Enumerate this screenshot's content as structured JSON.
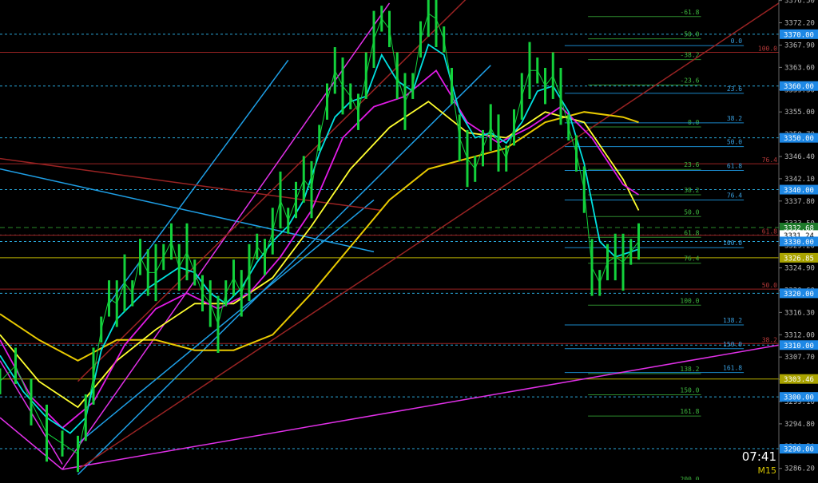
{
  "chart_data": {
    "type": "line",
    "timeframe": "M15",
    "clock": "07:41",
    "ylim": [
      3284.0,
      3376.6
    ],
    "xlim": [
      0,
      100
    ],
    "grid": false,
    "colors": {
      "background": "#000000",
      "price_bars": "#13d13b",
      "ema_fast": "#00e1e1",
      "ema_mid": "#e11be6",
      "ema_slow": "#ffff2f",
      "ma_long": "#e8c900",
      "ma_stair": "#6e66ff",
      "channel_blue": "#1e9fe6",
      "channel_magenta": "#e130e8",
      "trend_red": "#9a2323",
      "fib_green": "#2d8b2d",
      "fib_blue": "#1a87c8",
      "level_dashed": "#2aa6d8",
      "current_price": "#2a8a2a"
    },
    "price_ticks": [
      "3376.50",
      "3372.20",
      "3367.90",
      "3363.60",
      "3359.30",
      "3355.00",
      "3350.70",
      "3346.40",
      "3342.10",
      "3337.80",
      "3333.50",
      "3329.20",
      "3324.90",
      "3320.60",
      "3316.30",
      "3312.00",
      "3307.70",
      "3303.40",
      "3299.10",
      "3294.80",
      "3290.50",
      "3286.20"
    ],
    "tick_values": [
      3376.5,
      3372.2,
      3367.9,
      3363.6,
      3359.3,
      3355.0,
      3350.7,
      3346.4,
      3342.1,
      3337.8,
      3333.5,
      3329.2,
      3324.9,
      3320.6,
      3316.3,
      3312.0,
      3307.7,
      3303.4,
      3299.1,
      3294.8,
      3290.5,
      3286.2
    ],
    "level_labels": [
      {
        "text": "3370.00",
        "value": 3370.0,
        "color": "#1e88e5"
      },
      {
        "text": "3360.00",
        "value": 3360.0,
        "color": "#1e88e5"
      },
      {
        "text": "3350.00",
        "value": 3350.0,
        "color": "#1e88e5"
      },
      {
        "text": "3340.00",
        "value": 3340.0,
        "color": "#1e88e5"
      },
      {
        "text": "3332.68",
        "value": 3332.68,
        "color": "#1d7a2a"
      },
      {
        "text": "3331.24",
        "value": 3331.24,
        "color": "#ffffff"
      },
      {
        "text": "3330.00",
        "value": 3330.0,
        "color": "#1e88e5"
      },
      {
        "text": "3326.85",
        "value": 3326.85,
        "color": "#a9a300"
      },
      {
        "text": "3320.00",
        "value": 3320.0,
        "color": "#1e88e5"
      },
      {
        "text": "3310.00",
        "value": 3310.0,
        "color": "#1e88e5"
      },
      {
        "text": "3303.46",
        "value": 3303.46,
        "color": "#a9a300"
      },
      {
        "text": "3300.00",
        "value": 3300.0,
        "color": "#1e88e5"
      },
      {
        "text": "3290.00",
        "value": 3290.0,
        "color": "#1e88e5"
      }
    ],
    "fib_green_labels": [
      {
        "text": "-61.8",
        "value": 3373.4
      },
      {
        "text": "-50.0",
        "value": 3369.1
      },
      {
        "text": "-38.2",
        "value": 3365.1
      },
      {
        "text": "-23.6",
        "value": 3360.2
      },
      {
        "text": "0.0",
        "value": 3352.1
      },
      {
        "text": "23.6",
        "value": 3343.9
      },
      {
        "text": "38.2",
        "value": 3339.0
      },
      {
        "text": "50.0",
        "value": 3334.8
      },
      {
        "text": "61.8",
        "value": 3330.8
      },
      {
        "text": "76.4",
        "value": 3325.8
      },
      {
        "text": "100.0",
        "value": 3317.7
      },
      {
        "text": "138.2",
        "value": 3304.5
      },
      {
        "text": "150.0",
        "value": 3300.4
      },
      {
        "text": "161.8",
        "value": 3296.3
      },
      {
        "text": "200.0",
        "value": 3283.2
      }
    ],
    "fib_blue_labels": [
      {
        "text": "0.0",
        "value": 3367.8
      },
      {
        "text": "23.6",
        "value": 3358.6
      },
      {
        "text": "38.2",
        "value": 3352.9
      },
      {
        "text": "50.0",
        "value": 3348.3
      },
      {
        "text": "61.8",
        "value": 3343.7
      },
      {
        "text": "76.4",
        "value": 3338.0
      },
      {
        "text": "100.0",
        "value": 3328.8
      },
      {
        "text": "138.2",
        "value": 3313.9
      },
      {
        "text": "150.0",
        "value": 3309.3
      },
      {
        "text": "161.8",
        "value": 3304.7
      }
    ],
    "fib_red_labels": [
      {
        "text": "100.0",
        "value": 3366.5
      },
      {
        "text": "76.4",
        "value": 3345.0
      },
      {
        "text": "61.8",
        "value": 3331.2
      },
      {
        "text": "50.0",
        "value": 3320.8
      },
      {
        "text": "38.2",
        "value": 3310.3
      }
    ],
    "price_series": [
      [
        0,
        3303
      ],
      [
        2,
        3306
      ],
      [
        4,
        3299
      ],
      [
        6,
        3293
      ],
      [
        8,
        3291
      ],
      [
        10,
        3289
      ],
      [
        11,
        3296
      ],
      [
        12,
        3304
      ],
      [
        13,
        3313
      ],
      [
        14,
        3319
      ],
      [
        15,
        3318
      ],
      [
        16,
        3322
      ],
      [
        17,
        3320
      ],
      [
        18,
        3327
      ],
      [
        19,
        3324
      ],
      [
        20,
        3324
      ],
      [
        21,
        3327
      ],
      [
        22,
        3330
      ],
      [
        23,
        3325
      ],
      [
        24,
        3328
      ],
      [
        25,
        3324
      ],
      [
        26,
        3320
      ],
      [
        27,
        3318
      ],
      [
        28,
        3314
      ],
      [
        29,
        3320
      ],
      [
        30,
        3323
      ],
      [
        31,
        3320
      ],
      [
        32,
        3324
      ],
      [
        33,
        3329
      ],
      [
        34,
        3327
      ],
      [
        35,
        3332
      ],
      [
        36,
        3338
      ],
      [
        37,
        3334
      ],
      [
        38,
        3338
      ],
      [
        39,
        3342
      ],
      [
        40,
        3340
      ],
      [
        41,
        3350
      ],
      [
        42,
        3357
      ],
      [
        43,
        3363
      ],
      [
        44,
        3360
      ],
      [
        45,
        3358
      ],
      [
        46,
        3355
      ],
      [
        47,
        3362
      ],
      [
        48,
        3369
      ],
      [
        49,
        3373
      ],
      [
        50,
        3371
      ],
      [
        51,
        3362
      ],
      [
        52,
        3357
      ],
      [
        53,
        3360
      ],
      [
        54,
        3369
      ],
      [
        55,
        3374
      ],
      [
        56,
        3373
      ],
      [
        57,
        3369
      ],
      [
        58,
        3360
      ],
      [
        59,
        3350
      ],
      [
        60,
        3346
      ],
      [
        61,
        3344
      ],
      [
        62,
        3348
      ],
      [
        63,
        3352
      ],
      [
        64,
        3349
      ],
      [
        65,
        3346
      ],
      [
        66,
        3352
      ],
      [
        67,
        3358
      ],
      [
        68,
        3363
      ],
      [
        69,
        3363
      ],
      [
        70,
        3360
      ],
      [
        71,
        3362
      ],
      [
        72,
        3358
      ],
      [
        73,
        3352
      ],
      [
        74,
        3347
      ],
      [
        75,
        3340
      ],
      [
        76,
        3325
      ],
      [
        77,
        3322
      ],
      [
        78,
        3326
      ],
      [
        79,
        3327
      ],
      [
        80,
        3326
      ],
      [
        81,
        3328
      ],
      [
        82,
        3330
      ]
    ],
    "ema_fast": [
      [
        0,
        3308
      ],
      [
        3,
        3301
      ],
      [
        6,
        3296
      ],
      [
        9,
        3293
      ],
      [
        11,
        3296
      ],
      [
        13,
        3309
      ],
      [
        15,
        3315
      ],
      [
        17,
        3318
      ],
      [
        19,
        3321
      ],
      [
        21,
        3323
      ],
      [
        23,
        3325
      ],
      [
        25,
        3324
      ],
      [
        27,
        3320
      ],
      [
        29,
        3318
      ],
      [
        31,
        3321
      ],
      [
        33,
        3326
      ],
      [
        35,
        3330
      ],
      [
        37,
        3333
      ],
      [
        39,
        3338
      ],
      [
        41,
        3347
      ],
      [
        43,
        3354
      ],
      [
        45,
        3357
      ],
      [
        47,
        3358
      ],
      [
        49,
        3366
      ],
      [
        51,
        3361
      ],
      [
        53,
        3359
      ],
      [
        55,
        3368
      ],
      [
        57,
        3366
      ],
      [
        59,
        3355
      ],
      [
        61,
        3350
      ],
      [
        63,
        3351
      ],
      [
        65,
        3349
      ],
      [
        67,
        3353
      ],
      [
        69,
        3359
      ],
      [
        71,
        3360
      ],
      [
        73,
        3355
      ],
      [
        75,
        3345
      ],
      [
        77,
        3330
      ],
      [
        79,
        3327
      ],
      [
        81,
        3328
      ],
      [
        82,
        3328.5
      ]
    ],
    "ema_mid": [
      [
        0,
        3311
      ],
      [
        4,
        3300
      ],
      [
        8,
        3294
      ],
      [
        12,
        3299
      ],
      [
        16,
        3310
      ],
      [
        20,
        3317
      ],
      [
        24,
        3320
      ],
      [
        28,
        3317
      ],
      [
        32,
        3320
      ],
      [
        36,
        3327
      ],
      [
        40,
        3336
      ],
      [
        44,
        3350
      ],
      [
        48,
        3356
      ],
      [
        52,
        3358
      ],
      [
        56,
        3363
      ],
      [
        60,
        3353
      ],
      [
        64,
        3349
      ],
      [
        68,
        3352
      ],
      [
        72,
        3356
      ],
      [
        76,
        3350
      ],
      [
        80,
        3341
      ],
      [
        82,
        3339
      ]
    ],
    "ema_slow": [
      [
        0,
        3312
      ],
      [
        5,
        3303
      ],
      [
        10,
        3298
      ],
      [
        15,
        3307
      ],
      [
        20,
        3313
      ],
      [
        25,
        3318
      ],
      [
        30,
        3318
      ],
      [
        35,
        3323
      ],
      [
        40,
        3333
      ],
      [
        45,
        3344
      ],
      [
        50,
        3352
      ],
      [
        55,
        3357
      ],
      [
        60,
        3351
      ],
      [
        65,
        3350
      ],
      [
        70,
        3355
      ],
      [
        75,
        3353
      ],
      [
        80,
        3342
      ],
      [
        82,
        3336
      ]
    ],
    "ma_long": [
      [
        0,
        3316
      ],
      [
        5,
        3311
      ],
      [
        10,
        3307
      ],
      [
        15,
        3311
      ],
      [
        20,
        3311
      ],
      [
        25,
        3309
      ],
      [
        30,
        3309
      ],
      [
        35,
        3312
      ],
      [
        40,
        3320
      ],
      [
        45,
        3329
      ],
      [
        50,
        3338
      ],
      [
        55,
        3344
      ],
      [
        60,
        3346
      ],
      [
        65,
        3348
      ],
      [
        70,
        3353
      ],
      [
        75,
        3355
      ],
      [
        80,
        3354
      ],
      [
        82,
        3353
      ]
    ],
    "trendlines": [
      {
        "kind": "channel_blue",
        "points": [
          [
            0,
            3344
          ],
          [
            48,
            3328
          ]
        ]
      },
      {
        "kind": "channel_blue",
        "points": [
          [
            10,
            3285
          ],
          [
            63,
            3364
          ]
        ]
      },
      {
        "kind": "channel_blue",
        "points": [
          [
            14,
            3318
          ],
          [
            37,
            3365
          ]
        ]
      },
      {
        "kind": "channel_blue",
        "points": [
          [
            10,
            3291
          ],
          [
            48,
            3338
          ]
        ]
      },
      {
        "kind": "channel_magenta",
        "points": [
          [
            8,
            3286
          ],
          [
            50,
            3376
          ]
        ]
      },
      {
        "kind": "channel_magenta",
        "points": [
          [
            0,
            3296
          ],
          [
            8,
            3286
          ]
        ]
      },
      {
        "kind": "channel_magenta",
        "points": [
          [
            0,
            3307
          ],
          [
            8,
            3287
          ]
        ]
      },
      {
        "kind": "channel_magenta",
        "points": [
          [
            8,
            3286
          ],
          [
            100,
            3310
          ]
        ]
      },
      {
        "kind": "trend_red",
        "points": [
          [
            10,
            3303
          ],
          [
            60,
            3377
          ]
        ]
      },
      {
        "kind": "trend_red",
        "points": [
          [
            10,
            3286
          ],
          [
            100,
            3376
          ]
        ]
      },
      {
        "kind": "trend_red",
        "points": [
          [
            0,
            3346
          ],
          [
            49,
            3336
          ]
        ]
      }
    ]
  }
}
